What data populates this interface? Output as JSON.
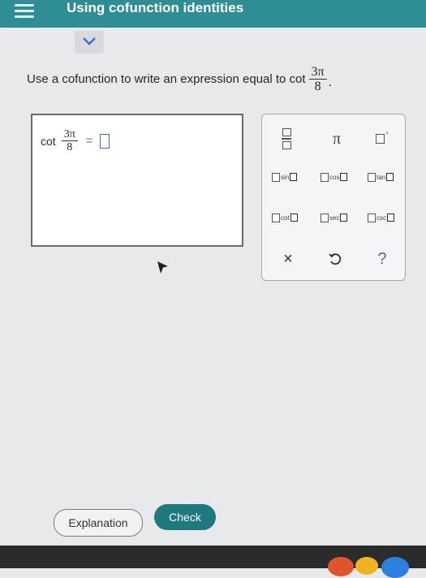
{
  "header": {
    "title": "Using cofunction identities"
  },
  "question": {
    "prompt": "Use a cofunction to write an expression equal to cot",
    "numerator": "3π",
    "denominator": "8",
    "end": "."
  },
  "answer": {
    "func": "cot",
    "numerator": "3π",
    "denominator": "8",
    "equals": "="
  },
  "keypad": {
    "pi_label": "π",
    "degree_label": "°",
    "trig": [
      "sin",
      "cos",
      "tan",
      "cot",
      "sec",
      "csc"
    ],
    "clear_label": "×",
    "help_label": "?"
  },
  "actions": {
    "explanation_label": "Explanation",
    "check_label": "Check"
  },
  "colors": {
    "header": "#2f8d94",
    "check_button": "#1f7a80",
    "slot_border": "#3c6fd0",
    "help": "#6a55b0"
  }
}
